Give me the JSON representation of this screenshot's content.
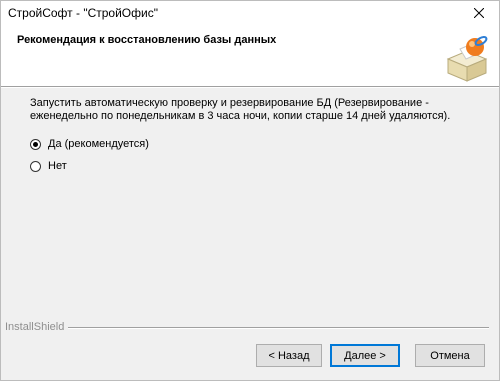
{
  "window": {
    "title": "СтройСофт - \"СтройОфис\""
  },
  "header": {
    "title": "Рекомендация к восстановлению базы данных",
    "icon": "installer-box-icon"
  },
  "body": {
    "description": "Запустить автоматическую проверку и резервирование БД (Резервирование - еженедельно по понедельникам в 3 часа ночи, копии старше 14 дней удаляются).",
    "options": [
      {
        "label": "Да (рекомендуется)",
        "selected": true
      },
      {
        "label": "Нет",
        "selected": false
      }
    ]
  },
  "footer": {
    "brand": "InstallShield",
    "back_label": "< Назад",
    "next_label": "Далее >",
    "cancel_label": "Отмена"
  },
  "colors": {
    "accent": "#0078d7",
    "header_bg": "#ffffff",
    "dialog_bg": "#f0f0f0"
  }
}
